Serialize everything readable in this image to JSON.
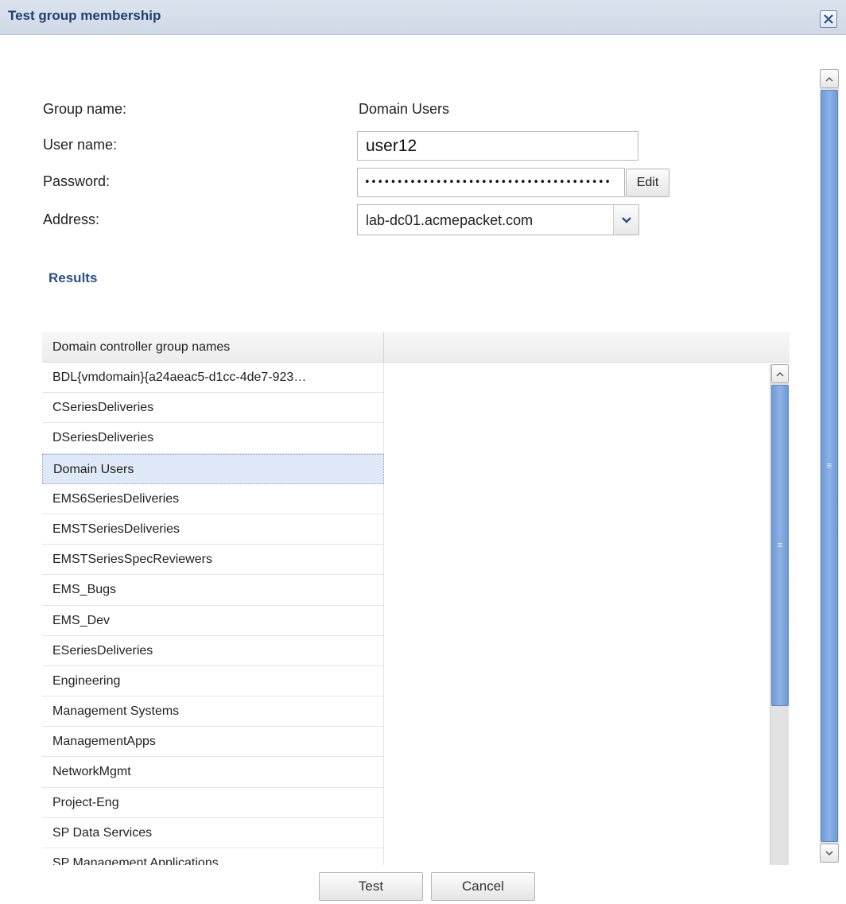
{
  "dialog": {
    "title": "Test group membership",
    "close_icon": "close-icon"
  },
  "form": {
    "group_name_label": "Group name:",
    "group_name_value": "Domain Users",
    "user_name_label": "User name:",
    "user_name_value": "user12",
    "password_label": "Password:",
    "password_value": "••••••••••••••••••••••••••••••••••••••",
    "edit_label": "Edit",
    "address_label": "Address:",
    "address_value": "lab-dc01.acmepacket.com"
  },
  "results": {
    "heading": "Results",
    "column_header": "Domain controller group names",
    "selected_index": 3,
    "rows": [
      "BDL{vmdomain}{a24aeac5-d1cc-4de7-923…",
      "CSeriesDeliveries",
      "DSeriesDeliveries",
      "Domain Users",
      "EMS6SeriesDeliveries",
      "EMSTSeriesDeliveries",
      "EMSTSeriesSpecReviewers",
      "EMS_Bugs",
      "EMS_Dev",
      "ESeriesDeliveries",
      "Engineering",
      "Management Systems",
      "ManagementApps",
      "NetworkMgmt",
      "Project-Eng",
      "SP Data Services",
      "SP Management Applications"
    ]
  },
  "footer": {
    "test_label": "Test",
    "cancel_label": "Cancel"
  },
  "colors": {
    "title_text": "#1f3f73",
    "results_heading": "#2a4f8a",
    "selected_row": "#dfe8f6",
    "scrollbar_thumb": "#7aa3dc"
  }
}
